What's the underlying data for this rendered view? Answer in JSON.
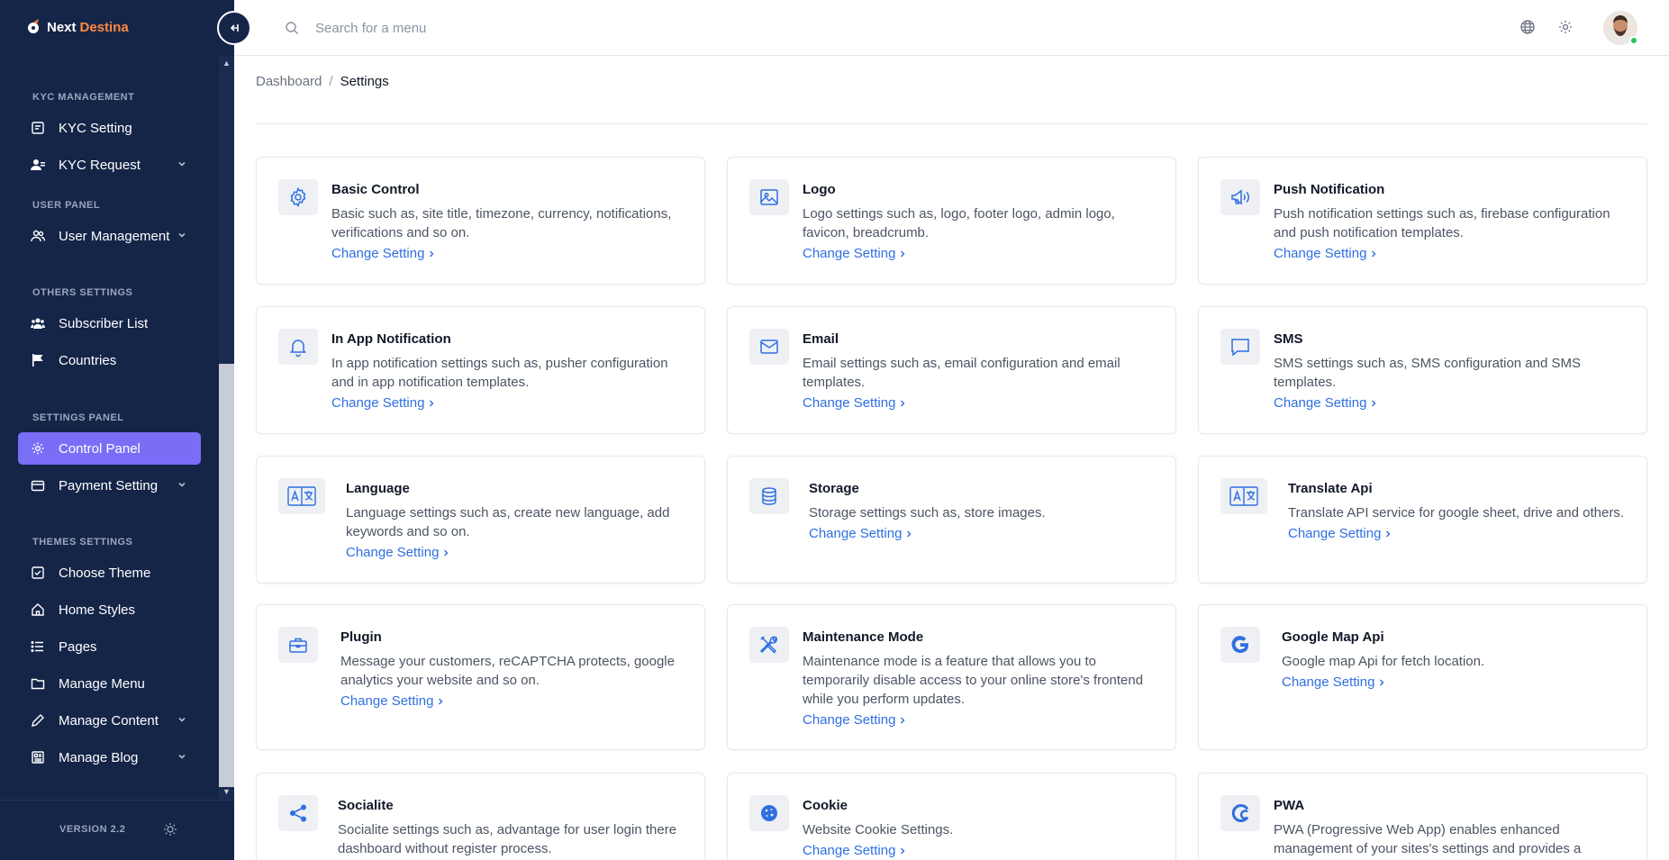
{
  "sidebar": {
    "brand": {
      "part1": "Next",
      "part2": "Destina"
    },
    "sections": [
      {
        "title": "KYC MANAGEMENT"
      },
      {
        "title": "USER PANEL"
      },
      {
        "title": "OTHERS SETTINGS"
      },
      {
        "title": "SETTINGS PANEL"
      },
      {
        "title": "THEMES SETTINGS"
      }
    ],
    "items": [
      {
        "label": "KYC Setting"
      },
      {
        "label": "KYC Request"
      },
      {
        "label": "User Management"
      },
      {
        "label": "Subscriber List"
      },
      {
        "label": "Countries"
      },
      {
        "label": "Control Panel"
      },
      {
        "label": "Payment Setting"
      },
      {
        "label": "Choose Theme"
      },
      {
        "label": "Home Styles"
      },
      {
        "label": "Pages"
      },
      {
        "label": "Manage Menu"
      },
      {
        "label": "Manage Content"
      },
      {
        "label": "Manage Blog"
      }
    ],
    "active_item": "Control Panel",
    "version": "VERSION 2.2",
    "accent_color": "#7b6ef6",
    "background_color": "#152548"
  },
  "header": {
    "search_placeholder": "Search for a menu",
    "icons": [
      "search-icon",
      "globe-icon",
      "gear-icon",
      "avatar"
    ]
  },
  "breadcrumb": {
    "root": "Dashboard",
    "separator": "/",
    "current": "Settings"
  },
  "link_label": "Change Setting",
  "cards": [
    {
      "title": "Basic Control",
      "description": "Basic such as, site title, timezone, currency, notifications, verifications and so on.",
      "icon": "gear-icon"
    },
    {
      "title": "Logo",
      "description": "Logo settings such as, logo, footer logo, admin logo, favicon, breadcrumb.",
      "icon": "image-icon"
    },
    {
      "title": "Push Notification",
      "description": "Push notification settings such as, firebase configuration and push notification templates.",
      "icon": "megaphone-icon"
    },
    {
      "title": "In App Notification",
      "description": "In app notification settings such as, pusher configuration and in app notification templates.",
      "icon": "bell-icon"
    },
    {
      "title": "Email",
      "description": "Email settings such as, email configuration and email templates.",
      "icon": "envelope-icon"
    },
    {
      "title": "SMS",
      "description": "SMS settings such as, SMS configuration and SMS templates.",
      "icon": "message-icon"
    },
    {
      "title": "Language",
      "description": "Language settings such as, create new language, add keywords and so on.",
      "icon": "language-icon"
    },
    {
      "title": "Storage",
      "description": "Storage settings such as, store images.",
      "icon": "database-icon"
    },
    {
      "title": "Translate Api",
      "description": "Translate API service for google sheet, drive and others.",
      "icon": "translate-icon"
    },
    {
      "title": "Plugin",
      "description": "Message your customers, reCAPTCHA protects, google analytics your website and so on.",
      "icon": "toolbox-icon"
    },
    {
      "title": "Maintenance Mode",
      "description": "Maintenance mode is a feature that allows you to temporarily disable access to your online store's frontend while you perform updates.",
      "icon": "tools-icon"
    },
    {
      "title": "Google Map Api",
      "description": "Google map Api for fetch location.",
      "icon": "google-icon"
    },
    {
      "title": "Socialite",
      "description": "Socialite settings such as, advantage for user login there dashboard without register process.",
      "icon": "share-icon"
    },
    {
      "title": "Cookie",
      "description": "Website Cookie Settings.",
      "icon": "cookie-icon"
    },
    {
      "title": "PWA",
      "description": "PWA (Progressive Web App) enables enhanced management of your sites's settings and provides a",
      "icon": "pwa-icon"
    }
  ]
}
